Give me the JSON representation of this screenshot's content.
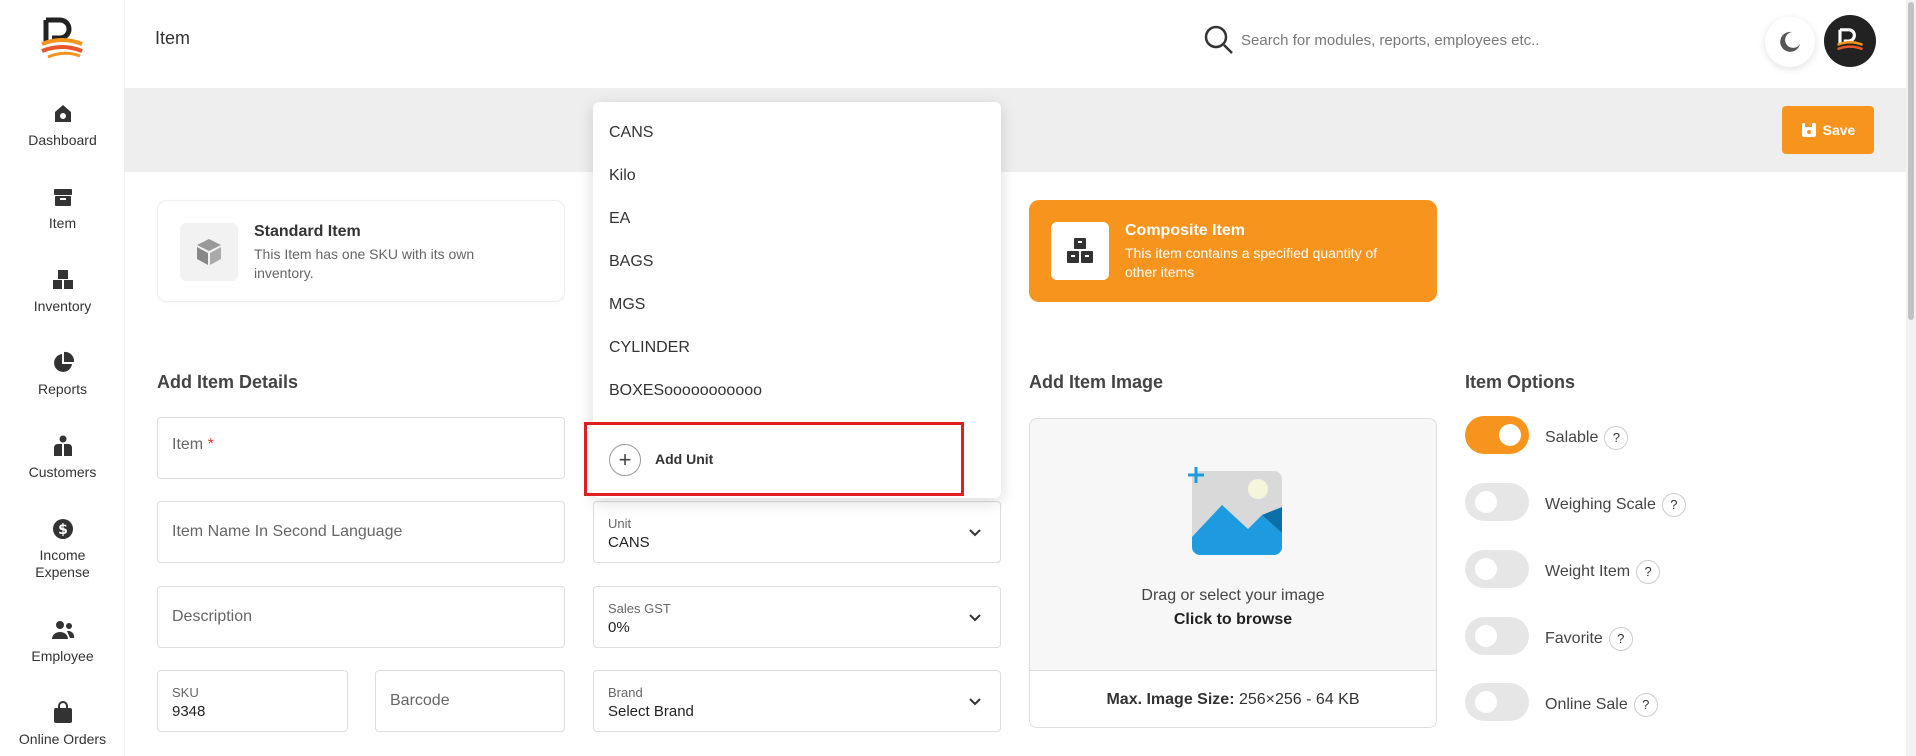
{
  "sidebar": {
    "items": [
      {
        "label": "Dashboard",
        "icon": "dashboard-icon"
      },
      {
        "label": "Item",
        "icon": "item-box-icon"
      },
      {
        "label": "Inventory",
        "icon": "inventory-boxes-icon"
      },
      {
        "label": "Reports",
        "icon": "pie-chart-icon"
      },
      {
        "label": "Customers",
        "icon": "customers-icon"
      },
      {
        "label": "Income Expense",
        "icon": "dollar-icon"
      },
      {
        "label": "Employee",
        "icon": "employee-icon"
      },
      {
        "label": "Online Orders",
        "icon": "shopping-bag-icon"
      }
    ]
  },
  "header": {
    "title": "Item",
    "search_placeholder": "Search for modules, reports, employees etc.."
  },
  "toolbar": {
    "save_label": "Save"
  },
  "item_types": {
    "standard": {
      "title": "Standard Item",
      "description": "This Item has one SKU with its own inventory."
    },
    "composite": {
      "title": "Composite Item",
      "description": "This item contains a specified quantity of other items"
    }
  },
  "sections": {
    "details_title": "Add Item Details",
    "image_title": "Add Item Image",
    "options_title": "Item Options"
  },
  "fields": {
    "item_label": "Item",
    "item_required_mark": "*",
    "second_language_placeholder": "Item Name In Second Language",
    "description_placeholder": "Description",
    "sku_label": "SKU",
    "sku_value": "9348",
    "barcode_placeholder": "Barcode",
    "unit_label": "Unit",
    "unit_value": "CANS",
    "gst_label": "Sales GST",
    "gst_value": "0%",
    "brand_label": "Brand",
    "brand_value": "Select Brand"
  },
  "unit_dropdown": {
    "options": [
      "CANS",
      "Kilo",
      "EA",
      "BAGS",
      "MGS",
      "CYLINDER",
      "BOXESooooooooooo"
    ],
    "add_label": "Add Unit"
  },
  "image_upload": {
    "drag_text": "Drag or select your image",
    "browse_text": "Click to browse",
    "size_label": "Max. Image Size:",
    "size_value": "256×256 - 64 KB"
  },
  "options": [
    {
      "label": "Salable",
      "enabled": true,
      "help": "?"
    },
    {
      "label": "Weighing Scale",
      "enabled": false,
      "help": "?"
    },
    {
      "label": "Weight Item",
      "enabled": false,
      "help": "?"
    },
    {
      "label": "Favorite",
      "enabled": false,
      "help": "?"
    },
    {
      "label": "Online Sale",
      "enabled": false,
      "help": "?"
    }
  ],
  "colors": {
    "accent": "#f7941d",
    "highlight_border": "#e02020"
  }
}
